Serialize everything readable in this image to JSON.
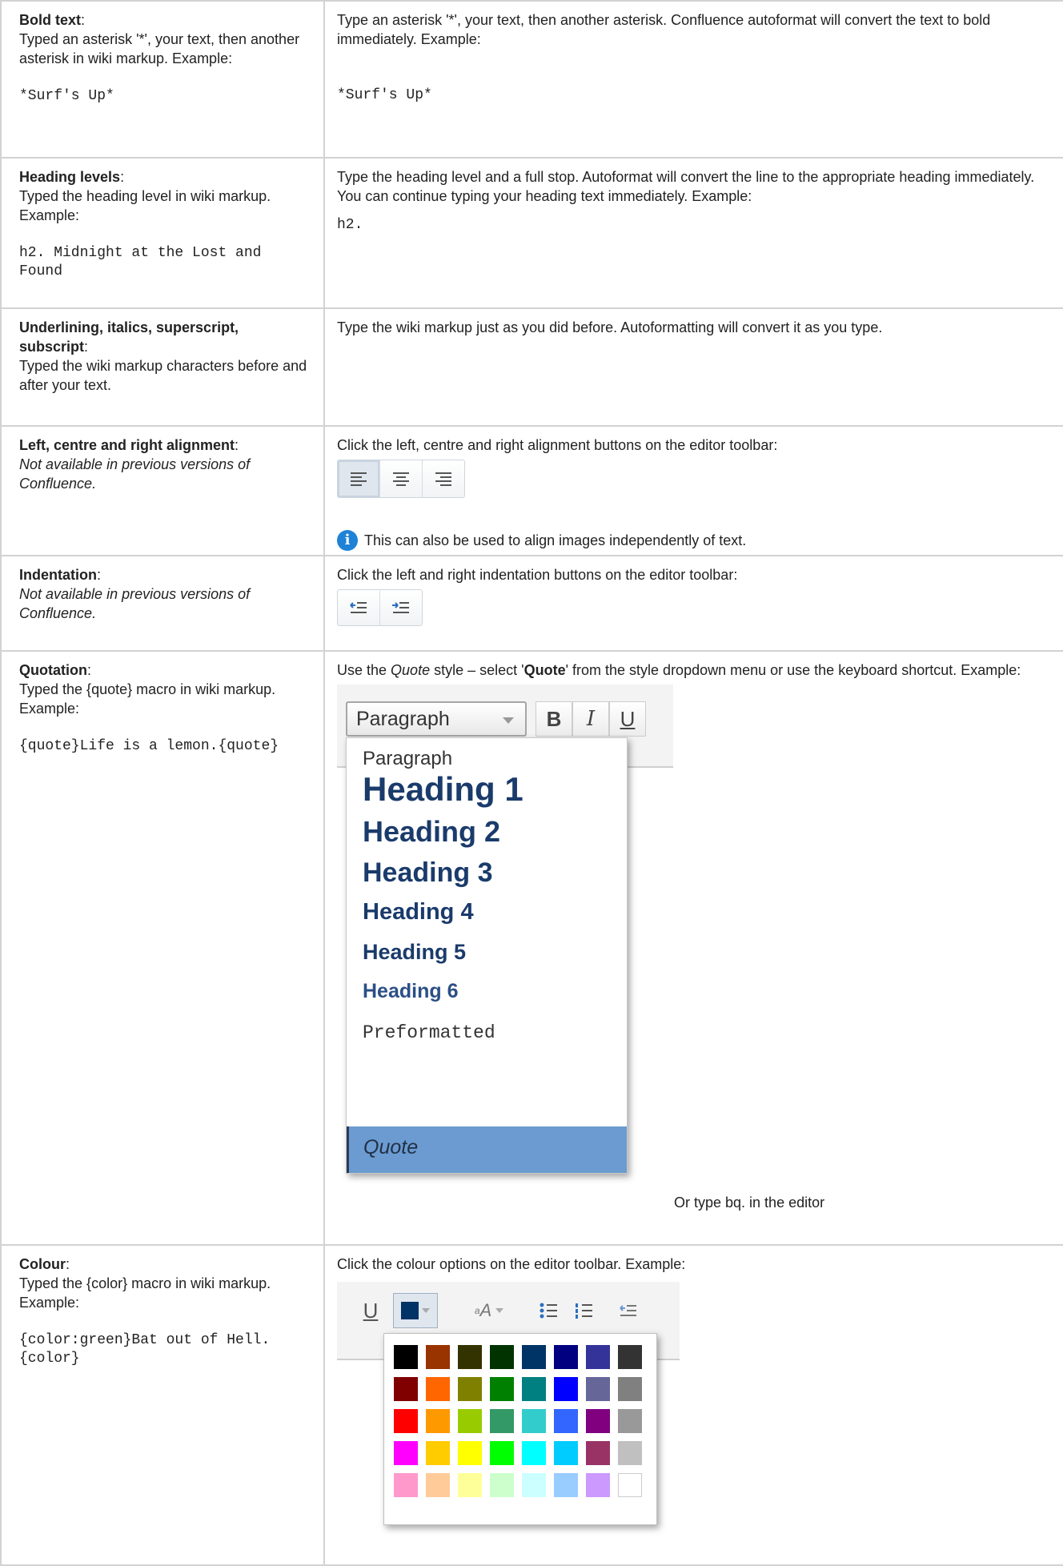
{
  "rows": {
    "bold": {
      "title": "Bold text",
      "desc": "Typed an asterisk '*', your text, then another asterisk in wiki markup. Example:",
      "code": "*Surf's Up*",
      "right_text": "Type an asterisk '*', your text, then another asterisk. Confluence autoformat will convert the text to bold immediately. Example:",
      "right_code": "*Surf's Up*"
    },
    "heading": {
      "title": "Heading levels",
      "desc": "Typed the heading level in wiki markup. Example:",
      "code": "h2. Midnight at the Lost and Found",
      "right_text": "Type the heading level and a full stop. Autoformat will convert the line to the appropriate heading immediately. You can continue typing your heading text immediately. Example:",
      "right_code": "h2."
    },
    "underline": {
      "title": "Underlining, italics, superscript, subscript",
      "desc": "Typed the wiki markup characters before and after your text.",
      "right_text": "Type the wiki markup just as you did before. Autoformatting will convert it as you type."
    },
    "alignment": {
      "title": "Left, centre and right alignment",
      "desc": "Not available in previous versions of Confluence.",
      "right_text": "Click the left, centre and right alignment buttons on the editor toolbar:",
      "note": "This can also be used to align images independently of text.",
      "info_glyph": "i"
    },
    "indent": {
      "title": "Indentation",
      "desc": "Not available in previous versions of Confluence.",
      "right_text": "Click the left and right indentation buttons on the editor toolbar:"
    },
    "quote": {
      "title": "Quotation",
      "desc": "Typed the {quote} macro in wiki markup. Example:",
      "code": "{quote}Life is a lemon.{quote}",
      "right_pre": "Use the ",
      "right_italic": "Quote",
      "right_mid": " style – select '",
      "right_bold": "Quote",
      "right_post": "' from the style dropdown menu or use the keyboard shortcut. Example:",
      "dropdown_value": "Paragraph",
      "toolbar": [
        "B",
        "I",
        "U"
      ],
      "menu": [
        "Paragraph",
        "Heading 1",
        "Heading 2",
        "Heading 3",
        "Heading 4",
        "Heading 5",
        "Heading 6",
        "Preformatted",
        "Quote"
      ],
      "after": "Or type bq. in the editor"
    },
    "colour": {
      "title": "Colour",
      "desc": "Typed the {color} macro in wiki markup. Example:",
      "code": "{color:green}Bat out of Hell.{color}",
      "right_text": "Click the colour options on the editor toolbar. Example:",
      "toolbar": [
        "U",
        "A"
      ],
      "palette": [
        [
          "#000000",
          "#993300",
          "#333300",
          "#003300",
          "#003366",
          "#000080",
          "#333399",
          "#333333"
        ],
        [
          "#800000",
          "#ff6600",
          "#808000",
          "#008000",
          "#008080",
          "#0000ff",
          "#666699",
          "#808080"
        ],
        [
          "#ff0000",
          "#ff9900",
          "#99cc00",
          "#339966",
          "#33cccc",
          "#3366ff",
          "#800080",
          "#999999"
        ],
        [
          "#ff00ff",
          "#ffcc00",
          "#ffff00",
          "#00ff00",
          "#00ffff",
          "#00ccff",
          "#993366",
          "#c0c0c0"
        ],
        [
          "#ff99cc",
          "#ffcc99",
          "#ffff99",
          "#ccffcc",
          "#ccffff",
          "#99ccff",
          "#cc99ff",
          "#ffffff"
        ]
      ],
      "selected_color": "#003366"
    }
  }
}
